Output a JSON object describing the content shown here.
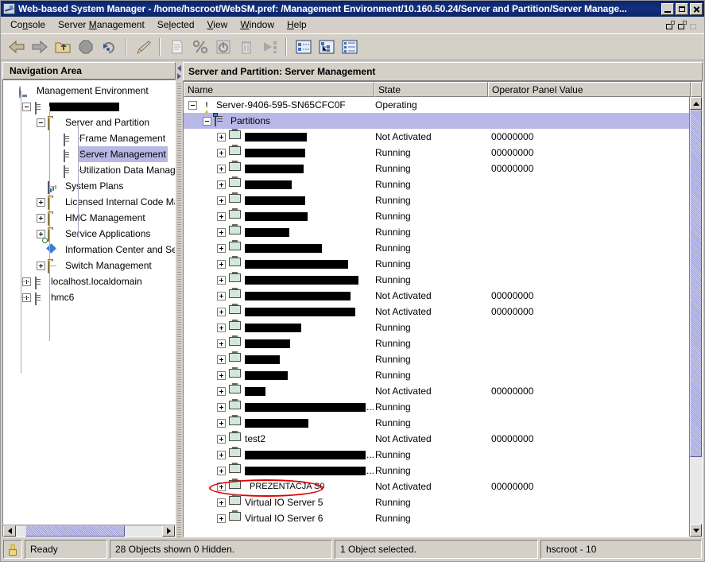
{
  "window": {
    "title": "Web-based System Manager - /home/hscroot/WebSM.pref: /Management Environment/10.160.50.24/Server and Partition/Server Manage...",
    "icon": "websm-icon",
    "buttons": {
      "minimize": "_",
      "maximize": "□",
      "close": "✕"
    }
  },
  "menubar": {
    "items": [
      {
        "pre": "Co",
        "mn": "n",
        "post": "sole"
      },
      {
        "pre": "Server ",
        "mn": "M",
        "post": "anagement"
      },
      {
        "pre": "Se",
        "mn": "l",
        "post": "ected"
      },
      {
        "pre": "",
        "mn": "V",
        "post": "iew"
      },
      {
        "pre": "",
        "mn": "W",
        "post": "indow"
      },
      {
        "pre": "",
        "mn": "H",
        "post": "elp"
      }
    ]
  },
  "toolbar": {
    "items": [
      {
        "name": "back-arrow-icon",
        "enabled": true
      },
      {
        "name": "forward-arrow-icon",
        "enabled": true
      },
      {
        "name": "up-folder-icon",
        "enabled": true
      },
      {
        "name": "stop-icon",
        "enabled": true
      },
      {
        "name": "refresh-icon",
        "enabled": true
      },
      {
        "name": "brush-icon",
        "enabled": true
      },
      {
        "name": "document-icon",
        "enabled": false
      },
      {
        "name": "percent-icon",
        "enabled": false
      },
      {
        "name": "power-icon",
        "enabled": false
      },
      {
        "name": "delete-trash-icon",
        "enabled": false
      },
      {
        "name": "run-icon",
        "enabled": false
      },
      {
        "name": "view-details-icon",
        "enabled": true
      },
      {
        "name": "view-tree-icon",
        "enabled": true
      },
      {
        "name": "view-tree-details-icon",
        "enabled": true
      }
    ]
  },
  "navigation": {
    "header": "Navigation Area",
    "tree": [
      {
        "label": "Management Environment",
        "depth": 0,
        "twist": "none",
        "icon": "globe-icon",
        "selected": false
      },
      {
        "label": "",
        "depth": 1,
        "twist": "minus",
        "icon": "server-icon",
        "selected": false,
        "redacted": true,
        "redact_width": 88
      },
      {
        "label": "Server and Partition",
        "depth": 2,
        "twist": "minus",
        "icon": "folder-icon",
        "selected": false
      },
      {
        "label": "Frame Management",
        "depth": 3,
        "twist": "none",
        "icon": "server-icon",
        "selected": false
      },
      {
        "label": "Server Management",
        "depth": 3,
        "twist": "none",
        "icon": "server-dark-icon",
        "selected": true
      },
      {
        "label": "Utilization Data Manag",
        "depth": 3,
        "twist": "none",
        "icon": "server-icon",
        "selected": false
      },
      {
        "label": "System Plans",
        "depth": 2,
        "twist": "none",
        "icon": "system-plans-icon",
        "selected": false
      },
      {
        "label": "Licensed Internal Code Ma",
        "depth": 2,
        "twist": "plus",
        "icon": "folder-icon",
        "selected": false
      },
      {
        "label": "HMC Management",
        "depth": 2,
        "twist": "plus",
        "icon": "folder-icon",
        "selected": false
      },
      {
        "label": "Service Applications",
        "depth": 2,
        "twist": "plus",
        "icon": "folder-icon",
        "selected": false
      },
      {
        "label": "Information Center and Se",
        "depth": 2,
        "twist": "none",
        "icon": "information-center-icon",
        "selected": false
      },
      {
        "label": "Switch Management",
        "depth": 2,
        "twist": "plus",
        "icon": "folder-icon",
        "selected": false
      },
      {
        "label": "localhost.localdomain",
        "depth": 1,
        "twist": "plus",
        "icon": "server-icon",
        "selected": false
      },
      {
        "label": "hmc6",
        "depth": 1,
        "twist": "plus",
        "icon": "server-icon",
        "selected": false
      }
    ]
  },
  "content": {
    "title": "Server and Partition: Server Management",
    "columns": [
      "Name",
      "State",
      "Operator Panel Value"
    ],
    "rows": [
      {
        "name": "Server-9406-595-SN65CFC0F",
        "state": "Operating",
        "op": "",
        "depth": 0,
        "twist": "minus",
        "icon": "warning-icon",
        "selected": false,
        "redacted": false
      },
      {
        "name": "Partitions",
        "state": "",
        "op": "",
        "depth": 1,
        "twist": "minus",
        "icon": "partitions-icon",
        "selected": true,
        "redacted": false
      },
      {
        "name": "",
        "state": "Not Activated",
        "op": "00000000",
        "depth": 2,
        "twist": "plus",
        "icon": "monitor-icon",
        "selected": false,
        "redacted": true,
        "redact_width": 78
      },
      {
        "name": "",
        "state": "Running",
        "op": "00000000",
        "depth": 2,
        "twist": "plus",
        "icon": "monitor-icon",
        "selected": false,
        "redacted": true,
        "redact_width": 76
      },
      {
        "name": "",
        "state": "Running",
        "op": "00000000",
        "depth": 2,
        "twist": "plus",
        "icon": "monitor-icon",
        "selected": false,
        "redacted": true,
        "redact_width": 74
      },
      {
        "name": "",
        "state": "Running",
        "op": "",
        "depth": 2,
        "twist": "plus",
        "icon": "monitor-icon",
        "selected": false,
        "redacted": true,
        "redact_width": 59
      },
      {
        "name": "",
        "state": "Running",
        "op": "",
        "depth": 2,
        "twist": "plus",
        "icon": "monitor-icon",
        "selected": false,
        "redacted": true,
        "redact_width": 76
      },
      {
        "name": "",
        "state": "Running",
        "op": "",
        "depth": 2,
        "twist": "plus",
        "icon": "monitor-icon",
        "selected": false,
        "redacted": true,
        "redact_width": 79
      },
      {
        "name": "",
        "state": "Running",
        "op": "",
        "depth": 2,
        "twist": "plus",
        "icon": "monitor-icon",
        "selected": false,
        "redacted": true,
        "redact_width": 56
      },
      {
        "name": "",
        "state": "Running",
        "op": "",
        "depth": 2,
        "twist": "plus",
        "icon": "monitor-icon",
        "selected": false,
        "redacted": true,
        "redact_width": 97
      },
      {
        "name": "",
        "state": "Running",
        "op": "",
        "depth": 2,
        "twist": "plus",
        "icon": "monitor-icon",
        "selected": false,
        "redacted": true,
        "redact_width": 130
      },
      {
        "name": "",
        "state": "Running",
        "op": "",
        "depth": 2,
        "twist": "plus",
        "icon": "monitor-icon",
        "selected": false,
        "redacted": true,
        "redact_width": 143
      },
      {
        "name": "",
        "state": "Not Activated",
        "op": "00000000",
        "depth": 2,
        "twist": "plus",
        "icon": "monitor-icon",
        "selected": false,
        "redacted": true,
        "redact_width": 133
      },
      {
        "name": "",
        "state": "Not Activated",
        "op": "00000000",
        "depth": 2,
        "twist": "plus",
        "icon": "monitor-icon",
        "selected": false,
        "redacted": true,
        "redact_width": 139
      },
      {
        "name": "",
        "state": "Running",
        "op": "",
        "depth": 2,
        "twist": "plus",
        "icon": "monitor-icon",
        "selected": false,
        "redacted": true,
        "redact_width": 71
      },
      {
        "name": "",
        "state": "Running",
        "op": "",
        "depth": 2,
        "twist": "plus",
        "icon": "monitor-icon",
        "selected": false,
        "redacted": true,
        "redact_width": 57
      },
      {
        "name": "",
        "state": "Running",
        "op": "",
        "depth": 2,
        "twist": "plus",
        "icon": "monitor-icon",
        "selected": false,
        "redacted": true,
        "redact_width": 44
      },
      {
        "name": "",
        "state": "Running",
        "op": "",
        "depth": 2,
        "twist": "plus",
        "icon": "monitor-icon",
        "selected": false,
        "redacted": true,
        "redact_width": 54
      },
      {
        "name": "",
        "state": "Not Activated",
        "op": "00000000",
        "depth": 2,
        "twist": "plus",
        "icon": "monitor-icon",
        "selected": false,
        "redacted": true,
        "redact_width": 26
      },
      {
        "name": "",
        "state": "Running",
        "op": "",
        "depth": 2,
        "twist": "plus",
        "icon": "monitor-icon",
        "selected": false,
        "redacted": true,
        "redact_width": 152,
        "ellipsis": true
      },
      {
        "name": "",
        "state": "Running",
        "op": "",
        "depth": 2,
        "twist": "plus",
        "icon": "monitor-icon",
        "selected": false,
        "redacted": true,
        "redact_width": 80
      },
      {
        "name": "test2",
        "state": "Not Activated",
        "op": "00000000",
        "depth": 2,
        "twist": "plus",
        "icon": "monitor-icon",
        "selected": false,
        "redacted": false
      },
      {
        "name": "",
        "state": "Running",
        "op": "",
        "depth": 2,
        "twist": "plus",
        "icon": "monitor-icon",
        "selected": false,
        "redacted": true,
        "redact_width": 155,
        "ellipsis": true
      },
      {
        "name": "",
        "state": "Running",
        "op": "",
        "depth": 2,
        "twist": "plus",
        "icon": "monitor-icon",
        "selected": false,
        "redacted": true,
        "redact_width": 152,
        "ellipsis": true
      },
      {
        "name": "PREZENTACJA S0",
        "state": "Not Activated",
        "op": "00000000",
        "depth": 2,
        "twist": "plus",
        "icon": "monitor-icon",
        "selected": false,
        "redacted": false,
        "annotated": true
      },
      {
        "name": "Virtual IO Server 5",
        "state": "Running",
        "op": "",
        "depth": 2,
        "twist": "plus",
        "icon": "monitor-icon",
        "selected": false,
        "redacted": false
      },
      {
        "name": "Virtual IO Server 6",
        "state": "Running",
        "op": "",
        "depth": 2,
        "twist": "plus",
        "icon": "monitor-icon",
        "selected": false,
        "redacted": false
      }
    ]
  },
  "annotation": {
    "shape": "ellipse",
    "color": "#e00000",
    "target": "PREZENTACJA S0"
  },
  "statusbar": {
    "lock_icon": "lock-icon",
    "ready": "Ready",
    "objects": "28 Objects shown 0 Hidden.",
    "selected": "1 Object selected.",
    "user": "hscroot - 10"
  },
  "colors": {
    "titlebar": "#0a246a",
    "selection": "#b8b8e8",
    "face": "#d4d0c8",
    "scroll_thumb": "#9a9ad8",
    "annotation": "#e00000"
  }
}
